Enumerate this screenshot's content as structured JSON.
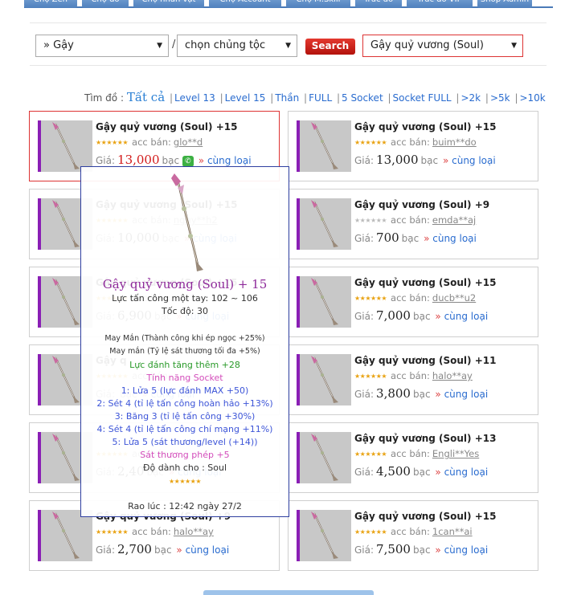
{
  "nav": {
    "tabs": [
      "Chợ Zen",
      "Chợ đồ",
      "Chợ nhân vật",
      "Chợ Account",
      "Chợ M.Skill",
      "Trúc đồ",
      "Trúc đồ VIP",
      "Shop Admin"
    ]
  },
  "toolbar": {
    "category_value": "» Gậy",
    "race_value": "chọn chủng tộc",
    "separator": "/",
    "search_label": "Search",
    "item_value": "Gậy quỷ vương (Soul)"
  },
  "filters": {
    "prefix": "Tìm đồ :",
    "all": "Tất cả",
    "items": [
      "Level 13",
      "Level 15",
      "Thần",
      "FULL",
      "5 Socket",
      "Socket FULL",
      ">2k",
      ">5k",
      ">10k"
    ]
  },
  "labels": {
    "seller_prefix": "acc bán:",
    "price_prefix": "Giá:",
    "currency": "bạc",
    "same_type": "cùng loại",
    "same_arrow": "»"
  },
  "listings": [
    {
      "name": "Gậy quỷ vương (Soul) +15",
      "seller": "glo**d",
      "price": "13,000",
      "rating": 5,
      "phone": true,
      "selected": true
    },
    {
      "name": "Gậy quỷ vương (Soul) +15",
      "seller": "buim**do",
      "price": "13,000",
      "rating": 5
    },
    {
      "name": "Gậy quỷ vương (Soul) +15",
      "seller": "nguy**h2",
      "price": "10,000",
      "rating": 5
    },
    {
      "name": "Gậy quỷ vương (Soul) +9",
      "seller": "emda**aj",
      "price": "700",
      "rating": 0
    },
    {
      "name": "Gậy quỷ vương (Soul) +15",
      "seller": "",
      "price": "6,900",
      "rating": 5
    },
    {
      "name": "Gậy quỷ vương (Soul) +15",
      "seller": "ducb**u2",
      "price": "7,000",
      "rating": 5
    },
    {
      "name": "Gậy q",
      "seller": "",
      "price": "",
      "rating": 5
    },
    {
      "name": "Gậy quỷ vương (Soul) +11",
      "seller": "halo**ay",
      "price": "3,800",
      "rating": 5
    },
    {
      "name": "",
      "seller": "",
      "price": "2,40",
      "rating": 5
    },
    {
      "name": "Gậy quỷ vương (Soul) +13",
      "seller": "Engli**Yes",
      "price": "4,500",
      "rating": 4
    },
    {
      "name": "Gậy quỷ vương (Soul) +9",
      "seller": "halo**ay",
      "price": "2,700",
      "rating": 5
    },
    {
      "name": "Gậy quỷ vương (Soul) +15",
      "seller": "1can**ai",
      "price": "7,500",
      "rating": 5
    }
  ],
  "tooltip": {
    "title": "Gậy quỷ vương (Soul) + 15",
    "attack": "Lực tấn công một tay: 102 ~ 106",
    "speed": "Tốc độ: 30",
    "luck1": "May Mắn (Thành công khi ép ngọc +25%)",
    "luck2": "May mắn (Tỷ lệ sát thương tối đa +5%)",
    "extra": "Lực đánh tăng thêm +28",
    "socket_header": "Tính năng Socket",
    "sockets": [
      "1: Lửa 5 (lực đánh MAX +50)",
      "2: Sét 4 (tỉ lệ tấn công hoàn hảo +13%)",
      "3: Băng 3 (tỉ lệ tấn công +30%)",
      "4: Sét 4 (tỉ lệ tấn công chí mạng +11%)",
      "5: Lửa 5 (sát thương/level (+14))"
    ],
    "magic": "Sát thương phép +5",
    "for_class": "Độ dành cho : Soul",
    "posted": "Rao lúc : 12:42 ngày 27/2"
  },
  "colors": {
    "accent_blue": "#2a6ccf",
    "rarity_purple": "#8a1fb5",
    "search_red": "#c81a12",
    "star_gold": "#e9a313"
  }
}
